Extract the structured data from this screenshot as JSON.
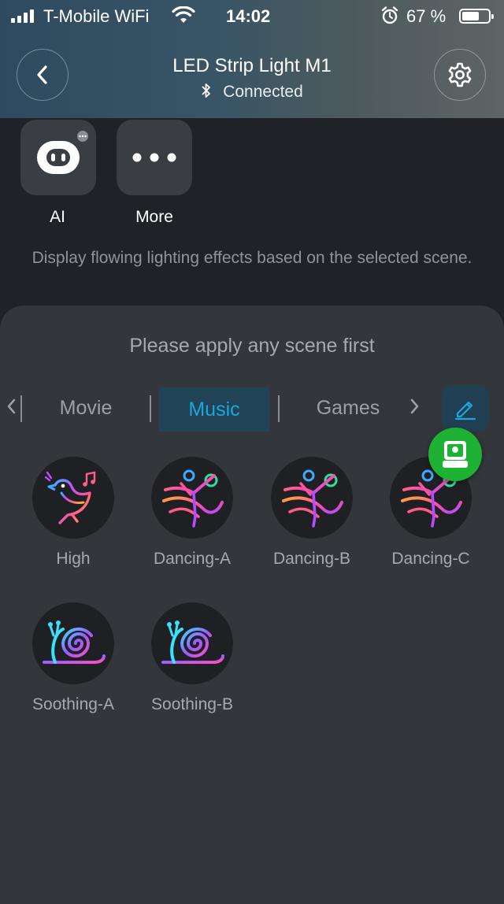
{
  "status_bar": {
    "carrier": "T-Mobile WiFi",
    "time": "14:02",
    "battery_percent": "67 %",
    "battery_level": 0.67,
    "icons": [
      "signal-icon",
      "wifi-icon",
      "alarm-icon",
      "battery-icon"
    ]
  },
  "header": {
    "title": "LED Strip Light M1",
    "status": "Connected",
    "icons": [
      "back-icon",
      "bluetooth-icon",
      "settings-icon"
    ]
  },
  "quick_actions": [
    {
      "label": "AI",
      "icon": "robot-face-icon"
    },
    {
      "label": "More",
      "icon": "more-dots-icon"
    }
  ],
  "description": "Display flowing lighting effects based on the selected scene.",
  "sheet": {
    "hint": "Please apply any scene first",
    "tabs": [
      {
        "label": "Movie",
        "active": false
      },
      {
        "label": "Music",
        "active": true
      },
      {
        "label": "Games",
        "active": false
      }
    ],
    "edit_icon": "pencil-icon",
    "scenes": [
      {
        "label": "High",
        "icon": "singing-bird-icon"
      },
      {
        "label": "Dancing-A",
        "icon": "dancer-icon"
      },
      {
        "label": "Dancing-B",
        "icon": "dancer-icon"
      },
      {
        "label": "Dancing-C",
        "icon": "dancer-icon"
      },
      {
        "label": "Soothing-A",
        "icon": "snail-icon"
      },
      {
        "label": "Soothing-B",
        "icon": "snail-icon"
      }
    ]
  },
  "colors": {
    "accent": "#1ba6dd",
    "floating_badge": "#1db233",
    "background": "#1f2328",
    "sheet": "#33363b"
  }
}
